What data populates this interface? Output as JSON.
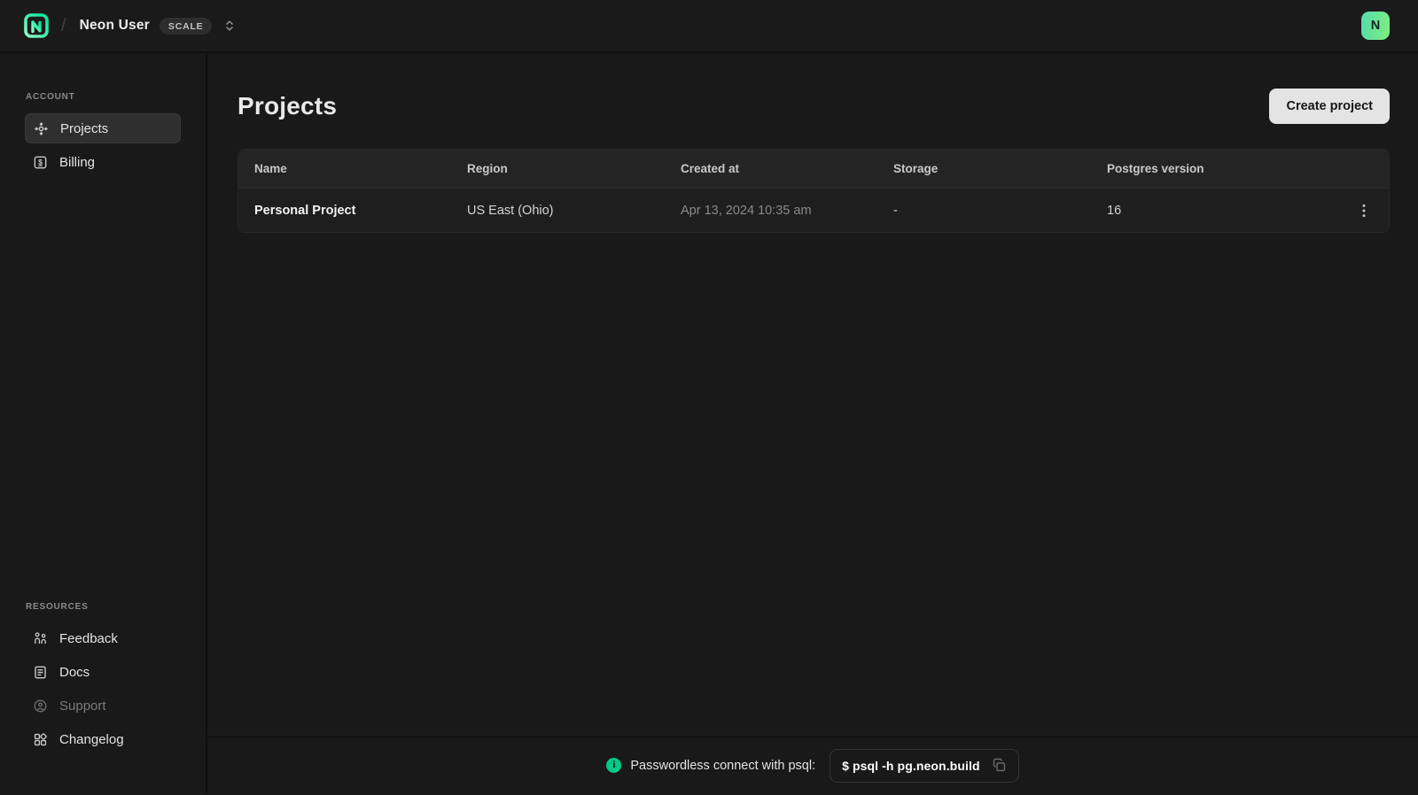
{
  "topbar": {
    "org_name": "Neon User",
    "plan_badge": "SCALE",
    "breadcrumb_separator": "/",
    "avatar_initial": "N"
  },
  "sidebar": {
    "sections": [
      {
        "label": "ACCOUNT",
        "items": [
          {
            "label": "Projects",
            "icon": "projects-icon",
            "active": true
          },
          {
            "label": "Billing",
            "icon": "billing-icon",
            "active": false
          }
        ]
      },
      {
        "label": "RESOURCES",
        "items": [
          {
            "label": "Feedback",
            "icon": "feedback-icon"
          },
          {
            "label": "Docs",
            "icon": "docs-icon"
          },
          {
            "label": "Support",
            "icon": "support-icon",
            "muted": true
          },
          {
            "label": "Changelog",
            "icon": "changelog-icon"
          }
        ]
      }
    ]
  },
  "main": {
    "title": "Projects",
    "create_project_label": "Create project",
    "table": {
      "columns": [
        "Name",
        "Region",
        "Created at",
        "Storage",
        "Postgres version"
      ],
      "rows": [
        {
          "name": "Personal Project",
          "region": "US East (Ohio)",
          "created_at": "Apr 13, 2024 10:35 am",
          "storage": "-",
          "postgres_version": "16"
        }
      ]
    }
  },
  "footer": {
    "message": "Passwordless connect with psql:",
    "command": "$ psql -h pg.neon.build"
  },
  "colors": {
    "brand_green": "#00e599",
    "info_green": "#00ca85",
    "background": "#191919",
    "table_header": "#242424",
    "table_row": "#1e1e1e",
    "button": "#e4e4e4"
  }
}
